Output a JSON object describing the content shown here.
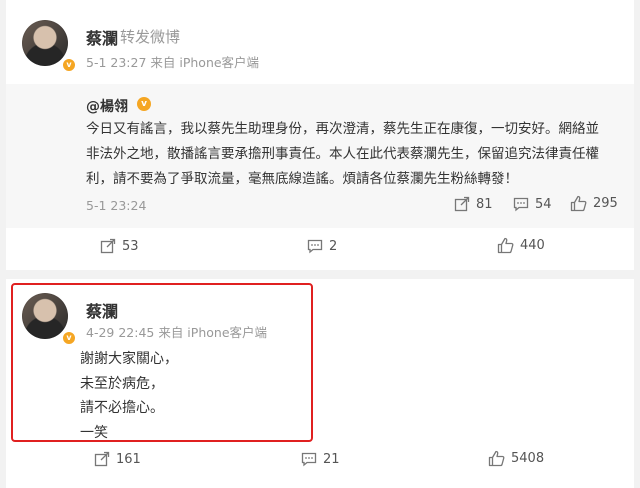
{
  "repost": {
    "author": "蔡瀾",
    "action": "转发微博",
    "meta": "5-1 23:27 来自 iPhone客户端",
    "quoted": {
      "author": "@楊翎",
      "text_lines": [
        "今日又有謠言，我以蔡先生助理身份，再次澄清，蔡先生正在康復，一切安好。網絡並",
        "非法外之地，散播謠言要承擔刑事責任。本人在此代表蔡瀾先生，保留追究法律責任權",
        "利，請不要為了爭取流量，毫無底線造謠。煩請各位蔡瀾先生粉絲轉發！"
      ],
      "time": "5-1 23:24",
      "stats": {
        "reposts": "81",
        "comments": "54",
        "likes": "295"
      }
    },
    "stats": {
      "reposts": "53",
      "comments": "2",
      "likes": "440"
    }
  },
  "post": {
    "author": "蔡瀾",
    "meta": "4-29 22:45 来自 iPhone客户端",
    "text_lines": [
      "謝謝大家關心，",
      "未至於病危，",
      "請不必擔心。",
      "一笑"
    ],
    "stats": {
      "reposts": "161",
      "comments": "21",
      "likes": "5408"
    }
  },
  "colors": {
    "verified_badge": "#f5a623",
    "highlight_border": "#e02020",
    "background": "#f2f2f2",
    "quote_bg": "#f7f7f7"
  },
  "icons": [
    "share-icon",
    "comment-icon",
    "like-icon",
    "verified-icon"
  ]
}
